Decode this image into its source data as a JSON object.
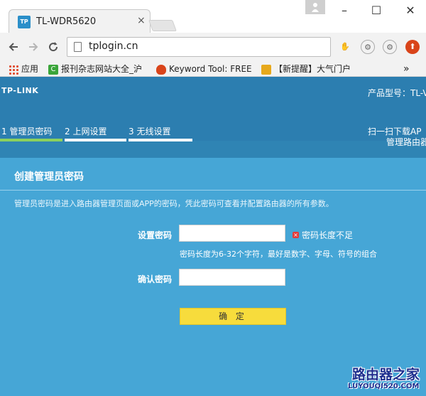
{
  "browser": {
    "tab_title": "TL-WDR5620",
    "tab_favicon_text": "TP",
    "tab_close": "×",
    "url": "tplogin.cn",
    "window": {
      "minimize": "–",
      "maximize": "☐",
      "close": "✕"
    },
    "bookmarks": [
      {
        "label": "应用",
        "icon": "apps-grid-icon"
      },
      {
        "label": "报刊杂志网站大全_沪",
        "icon": "c-badge-icon",
        "color": "#3aa53a"
      },
      {
        "label": "Keyword Tool: FREE",
        "icon": "flame-icon",
        "color": "#d9441a"
      },
      {
        "label": "【新提醒】大气门户",
        "icon": "trophy-icon",
        "color": "#e7a91c"
      }
    ],
    "bookmark_more": "»"
  },
  "router": {
    "brand": "TP-LINK",
    "model_label": "产品型号：TL-V",
    "steps": [
      {
        "label": "1 管理员密码",
        "active": true
      },
      {
        "label": "2 上网设置",
        "active": false
      },
      {
        "label": "3 无线设置",
        "active": false
      }
    ],
    "qr_line1": "扫一扫下载AP",
    "qr_line2": "管理路由器",
    "panel": {
      "title": "创建管理员密码",
      "description": "管理员密码是进入路由器管理页面或APP的密码，凭此密码可查看并配置路由器的所有参数。",
      "set_password_label": "设置密码",
      "confirm_password_label": "确认密码",
      "error_text": "密码长度不足",
      "hint": "密码长度为6-32个字符，最好是数字、字母、符号的组合",
      "confirm_button": "确 定"
    }
  },
  "watermark": {
    "main": "路由器之家",
    "sub": "LUYOUQI520.COM"
  },
  "colors": {
    "header_blue": "#2c7eb0",
    "panel_blue": "#46a6d6",
    "active_step": "#8bd15d",
    "button_yellow": "#f7dc3c",
    "error_red": "#e23b3b"
  }
}
